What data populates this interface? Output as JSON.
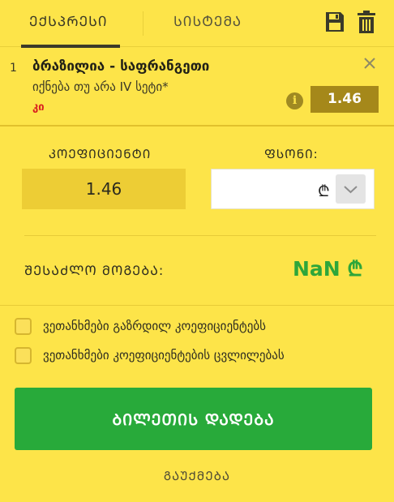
{
  "tabs": [
    {
      "label": "ᲔᲥᲡᲞᲠᲔᲡᲘ",
      "active": true
    },
    {
      "label": "ᲡᲘᲡᲢᲔᲛᲐ",
      "active": false
    }
  ],
  "toolbar": {
    "save_icon": "save-icon",
    "trash_icon": "trash-icon"
  },
  "bet": {
    "index": "1",
    "match": "ბრაზილია - საფრანგეთი",
    "market": "იქნება თუ არა IV სეტი*",
    "outcome": "კი",
    "odds": "1.46"
  },
  "coefficient": {
    "label": "ᲙᲝᲔᲤᲘᲪᲘᲔᲜᲢᲘ",
    "value": "1.46"
  },
  "stake": {
    "label": "ᲤᲡᲝᲜᲘ:",
    "value": "",
    "currency": "₾"
  },
  "winnings": {
    "label": "ᲨᲔᲡᲐᲫᲚᲝ ᲛᲝᲒᲔᲑᲐ:",
    "value": "NaN ₾"
  },
  "options": [
    {
      "label": "ვეთანხმები გაზრდილ კოეფიციენტებს",
      "checked": false
    },
    {
      "label": "ვეთანხმები კოეფიციენტების ცვლილებას",
      "checked": false
    }
  ],
  "actions": {
    "place_bet": "ᲑᲘᲚᲔᲗᲘᲡ ᲓᲐᲓᲔᲑᲐ",
    "cancel": "ᲒᲐᲣᲥᲛᲔᲑᲐ"
  },
  "colors": {
    "background": "#fde449",
    "odds_badge": "#a5881a",
    "place_bet": "#28aa3a",
    "winnings": "#2ea63a",
    "outcome": "#d91f1f"
  }
}
